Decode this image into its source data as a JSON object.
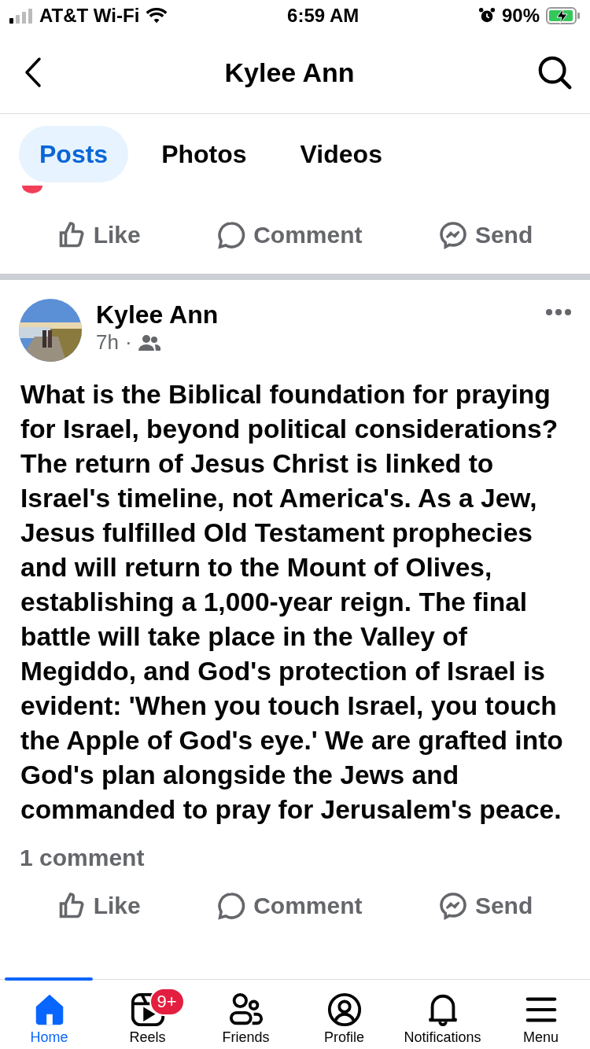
{
  "status_bar": {
    "carrier": "AT&T Wi-Fi",
    "time": "6:59 AM",
    "battery": "90%"
  },
  "header": {
    "title": "Kylee Ann"
  },
  "tabs": [
    {
      "label": "Posts",
      "selected": true
    },
    {
      "label": "Photos",
      "selected": false
    },
    {
      "label": "Videos",
      "selected": false
    }
  ],
  "top_actions": [
    {
      "kind": "like",
      "label": "Like"
    },
    {
      "kind": "comment",
      "label": "Comment"
    },
    {
      "kind": "send",
      "label": "Send"
    }
  ],
  "post": {
    "author": "Kylee Ann",
    "time": "7h",
    "separator": "·",
    "text": "What is the Biblical foundation for praying for Israel, beyond political considerations? The return of Jesus Christ is linked to Israel's timeline, not America's. As a Jew, Jesus fulfilled Old Testament prophecies and will return to the Mount of Olives, establishing a 1,000-year reign. The final battle will take place in the Valley of Megiddo, and God's protection of Israel is evident: 'When you touch Israel, you touch the Apple of God's eye.' We are grafted into God's plan alongside the Jews and commanded to pray for Jerusalem's peace.",
    "comments": "1 comment",
    "actions": [
      {
        "kind": "like",
        "label": "Like"
      },
      {
        "kind": "comment",
        "label": "Comment"
      },
      {
        "kind": "send",
        "label": "Send"
      }
    ]
  },
  "nav": [
    {
      "kind": "home",
      "label": "Home",
      "selected": true
    },
    {
      "kind": "reels",
      "label": "Reels",
      "selected": false,
      "badge": "9+"
    },
    {
      "kind": "friends",
      "label": "Friends",
      "selected": false
    },
    {
      "kind": "profile",
      "label": "Profile",
      "selected": false
    },
    {
      "kind": "notifications",
      "label": "Notifications",
      "selected": false
    },
    {
      "kind": "menu",
      "label": "Menu",
      "selected": false
    }
  ]
}
